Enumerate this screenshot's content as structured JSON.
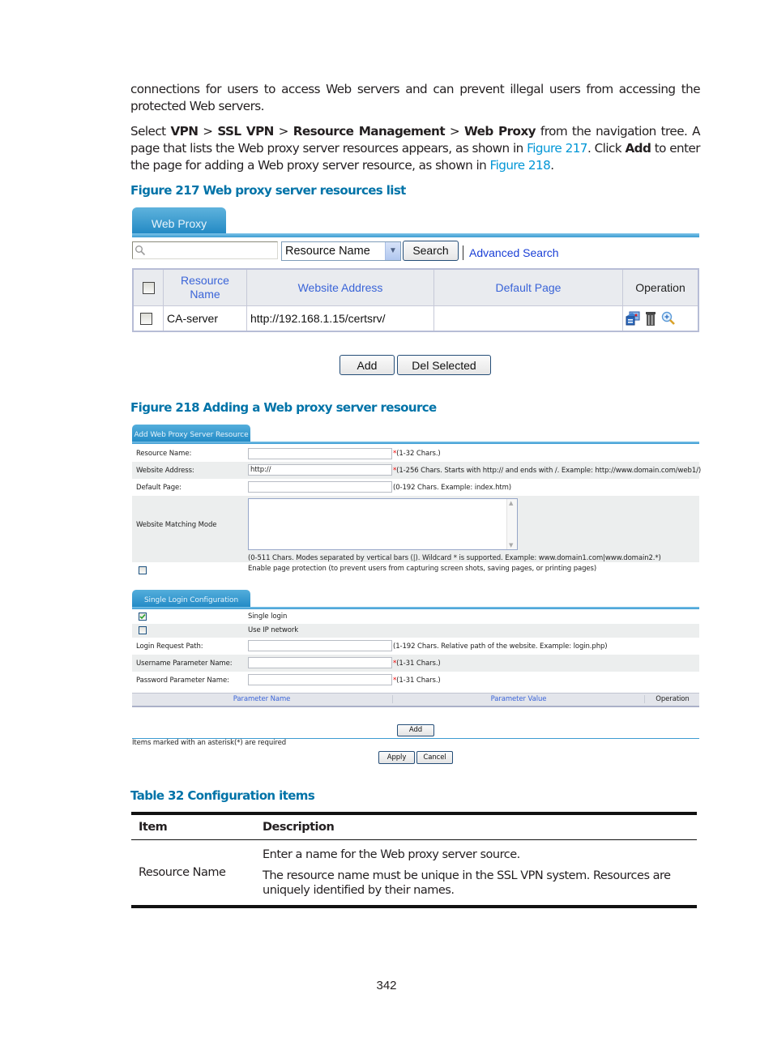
{
  "body_text": {
    "para1": "connections for users to access Web servers and can prevent illegal users from accessing the protected Web servers.",
    "para2": {
      "prefix": "Select ",
      "nav": [
        "VPN",
        "SSL VPN",
        "Resource Management",
        "Web Proxy"
      ],
      "separator": " > ",
      "mid1": " from the navigation tree. A page that lists the Web proxy server resources appears, as shown in ",
      "xref1": "Figure 217",
      "mid2": ". Click ",
      "bold_add": "Add",
      "mid3": " to enter the page for adding a Web proxy server resource, as shown in ",
      "xref2": "Figure 218",
      "end": "."
    }
  },
  "figure217": {
    "caption": "Figure 217 Web proxy server resources list",
    "tab_label": "Web Proxy",
    "search": {
      "value": "",
      "icon": "search-icon"
    },
    "search_field_select": "Resource Name",
    "search_button": "Search",
    "advanced_search": "Advanced Search",
    "table": {
      "columns": [
        "Resource Name",
        "Website Address",
        "Default Page",
        "Operation"
      ],
      "rows": [
        {
          "checked": false,
          "resource_name": "CA-server",
          "website_address": "http://192.168.1.15/certsrv/",
          "default_page": "",
          "operations": [
            "modify-icon",
            "delete-icon",
            "view-details-icon"
          ]
        }
      ]
    },
    "buttons": {
      "add": "Add",
      "del_selected": "Del Selected"
    }
  },
  "figure218": {
    "caption": "Figure 218 Adding a Web proxy server resource",
    "tab_label": "Add Web Proxy Server Resource",
    "fields": [
      {
        "label": "Resource Name:",
        "value": "",
        "required": true,
        "hint": "(1-32 Chars.)"
      },
      {
        "label": "Website Address:",
        "value": "http://",
        "required": true,
        "hint": "(1-256 Chars. Starts with http:// and ends with /. Example: http://www.domain.com/web1/)"
      },
      {
        "label": "Default Page:",
        "value": "",
        "required": false,
        "hint": "(0-192 Chars. Example: index.htm)"
      }
    ],
    "matching_mode": {
      "label": "Website Matching Mode",
      "value": "",
      "hint": "(0-511 Chars. Modes separated by vertical bars (|). Wildcard * is supported. Example: www.domain1.com|www.domain2.*)"
    },
    "page_protection": {
      "checked": false,
      "label": "Enable page protection (to prevent users from capturing screen shots, saving pages, or printing pages)"
    },
    "sso_tab_label": "Single Login Configuration",
    "single_login": {
      "checked": true,
      "label": "Single login"
    },
    "use_ip_network": {
      "checked": false,
      "label": "Use IP network"
    },
    "sso_fields": [
      {
        "label": "Login Request Path:",
        "value": "",
        "required": false,
        "hint": "(1-192 Chars. Relative path of the website. Example: login.php)"
      },
      {
        "label": "Username Parameter Name:",
        "value": "",
        "required": true,
        "hint": "(1-31 Chars.)"
      },
      {
        "label": "Password Parameter Name:",
        "value": "",
        "required": true,
        "hint": "(1-31 Chars.)"
      }
    ],
    "param_table_columns": [
      "Parameter Name",
      "Parameter Value",
      "Operation"
    ],
    "add_button": "Add",
    "required_note": "Items marked with an asterisk(*) are required",
    "apply_button": "Apply",
    "cancel_button": "Cancel",
    "asterisk": "*"
  },
  "table32": {
    "caption": "Table 32 Configuration items",
    "columns": [
      "Item",
      "Description"
    ],
    "rows": [
      {
        "item": "Resource Name",
        "description": [
          "Enter a name for the Web proxy server source.",
          "The resource name must be unique in the SSL VPN system. Resources are uniquely identified by their names."
        ]
      }
    ]
  },
  "page_number": "342"
}
